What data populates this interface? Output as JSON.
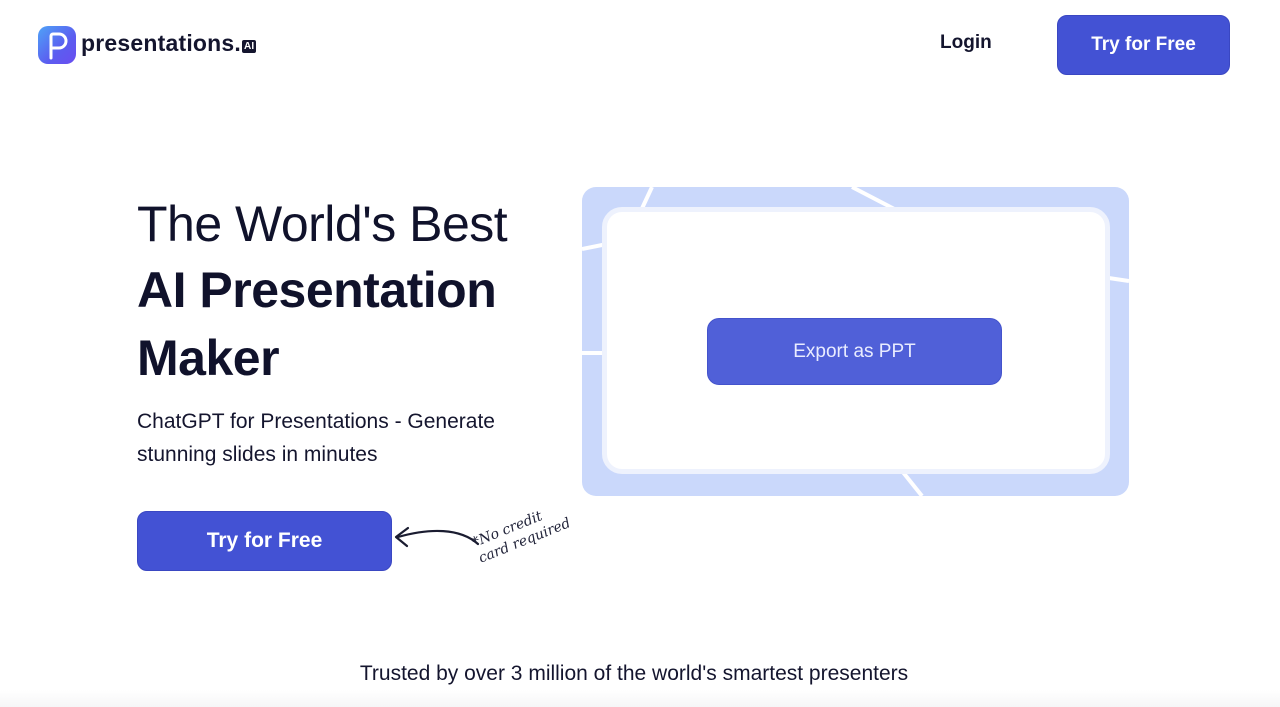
{
  "header": {
    "logo_text": "presentations",
    "logo_suffix": "AI",
    "login_label": "Login",
    "cta_label": "Try for Free"
  },
  "hero": {
    "title_line1": "The World's Best",
    "title_line2": "AI Presentation",
    "title_line3": "Maker",
    "subtitle": "ChatGPT for Presentations - Generate stunning slides in minutes",
    "cta_label": "Try for Free",
    "note_line1": "*No credit",
    "note_line2": "card required"
  },
  "preview": {
    "export_label": "Export as PPT"
  },
  "trusted_text": "Trusted by over 3 million of the world's smartest presenters",
  "colors": {
    "primary": "#4352d4",
    "card_bg": "#cad8fb",
    "text": "#10122b"
  }
}
